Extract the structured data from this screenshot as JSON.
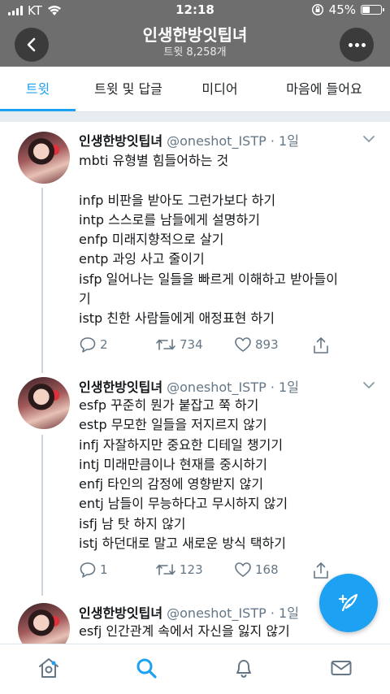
{
  "status_bar": {
    "carrier": "KT",
    "time": "12:18",
    "battery": "45%",
    "battery_level": 0.45
  },
  "header": {
    "title": "인생한방잇팁녀",
    "tweet_count": "트윗 8,258개"
  },
  "tabs": [
    {
      "label": "트윗",
      "active": true
    },
    {
      "label": "트윗 및 답글",
      "active": false
    },
    {
      "label": "미디어",
      "active": false
    },
    {
      "label": "마음에 들어요",
      "active": false
    }
  ],
  "tweets": [
    {
      "name": "인생한방잇팁녀",
      "handle": "@oneshot_ISTP · 1일",
      "lines": [
        "mbti 유형별 힘들어하는 것",
        "",
        "infp 비판을 받아도 그런가보다 하기",
        "intp 스스로를 남들에게 설명하기",
        "enfp 미래지향적으로 살기",
        "entp 과잉 사고 줄이기",
        "isfp 일어나는 일들을 빠르게 이해하고 받아들이",
        "기",
        "istp 친한 사람들에게 애정표현 하기"
      ],
      "replies": "2",
      "retweets": "734",
      "likes": "893"
    },
    {
      "name": "인생한방잇팁녀",
      "handle": "@oneshot_ISTP · 1일",
      "lines": [
        "esfp 꾸준히 뭔가 붙잡고 쭉 하기",
        "estp 무모한 일들을 저지르지 않기",
        "infj 자잘하지만 중요한 디테일 챙기기",
        "intj 미래만큼이나 현재를 중시하기",
        "enfj 타인의 감정에 영향받지 않기",
        "entj 남들이 무능하다고 무시하지 않기",
        "isfj 남 탓 하지 않기",
        "istj 하던대로 말고 새로운 방식 택하기"
      ],
      "replies": "1",
      "retweets": "123",
      "likes": "168"
    },
    {
      "name": "인생한방잇팁녀",
      "handle": "@oneshot_ISTP · 1일",
      "lines": [
        "esfj 인간관계 속에서 자신을 잃지 않기"
      ]
    }
  ],
  "icons": {
    "back": "chevron-left-icon",
    "more": "more-dots-icon",
    "compose": "compose-feather-icon",
    "nav": [
      "home-icon",
      "search-icon",
      "notifications-bell-icon",
      "messages-envelope-icon"
    ]
  },
  "colors": {
    "accent": "#1da1f2",
    "header_bg": "#6e6e6e",
    "secondary_text": "#657786"
  }
}
